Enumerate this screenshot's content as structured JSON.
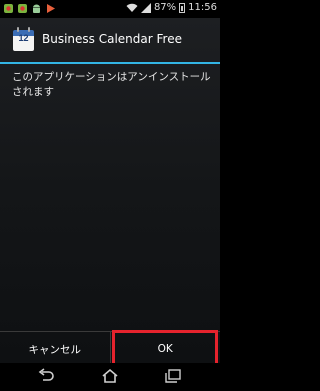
{
  "status_bar": {
    "battery_percent": "87%",
    "time": "11:56",
    "left_icons": [
      "notification-icon-1",
      "notification-icon-2",
      "android-icon",
      "play-icon"
    ]
  },
  "dialog": {
    "app_icon_day": "12",
    "title": "Business Calendar Free",
    "message": "このアプリケーションはアンインストールされます",
    "cancel_label": "キャンセル",
    "ok_label": "OK"
  },
  "nav_bar": {
    "icons": [
      "back-icon",
      "home-icon",
      "recent-apps-icon"
    ]
  },
  "colors": {
    "accent": "#33b5e5",
    "highlight": "#e5232d"
  }
}
